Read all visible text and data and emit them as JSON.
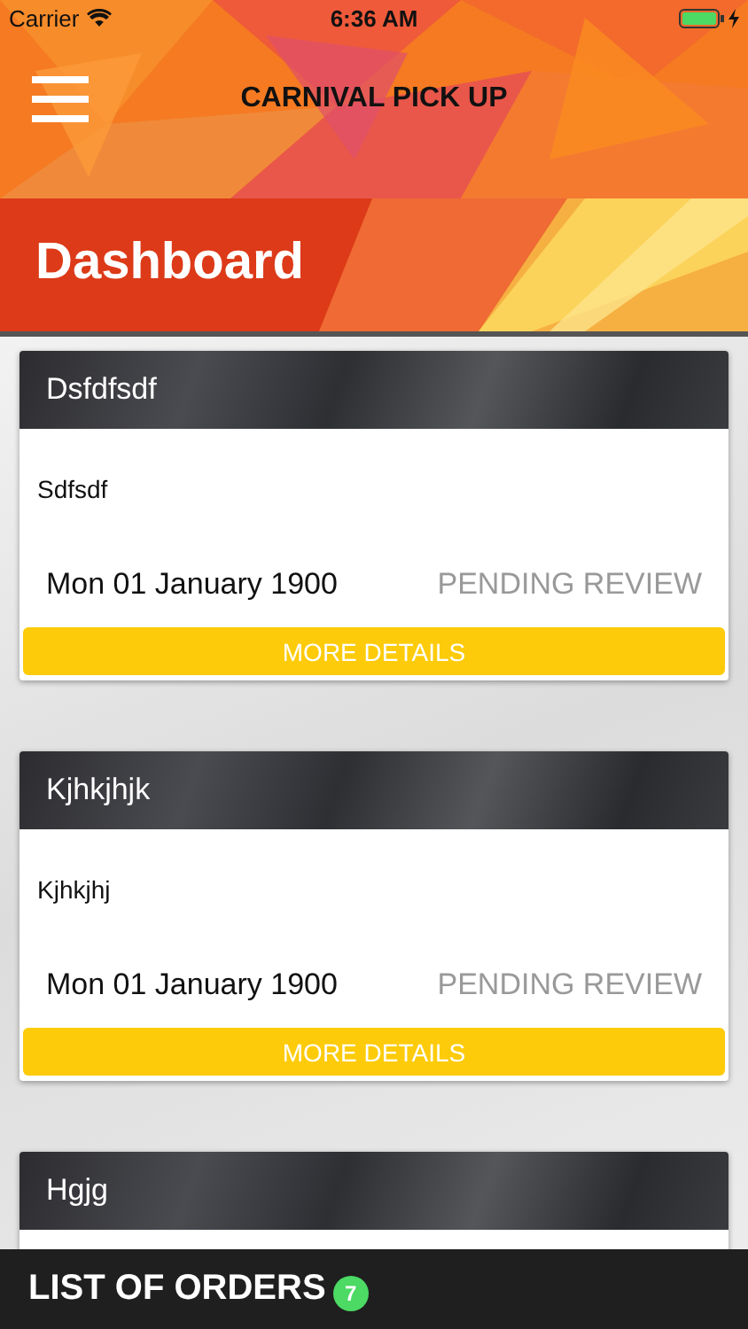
{
  "status_bar": {
    "carrier": "Carrier",
    "time": "6:36 AM"
  },
  "header": {
    "title": "CARNIVAL PICK UP"
  },
  "page_title": "Dashboard",
  "orders": [
    {
      "title": "Dsfdfsdf",
      "description": "Sdfsdf",
      "date": "Mon 01 January 1900",
      "status": "PENDING REVIEW",
      "button": "MORE DETAILS"
    },
    {
      "title": "Kjhkjhjk",
      "description": "Kjhkjhj",
      "date": "Mon 01 January 1900",
      "status": "PENDING REVIEW",
      "button": "MORE DETAILS"
    },
    {
      "title": "Hgjg"
    }
  ],
  "bottom_bar": {
    "label": "LIST OF ORDERS",
    "count": "7"
  }
}
